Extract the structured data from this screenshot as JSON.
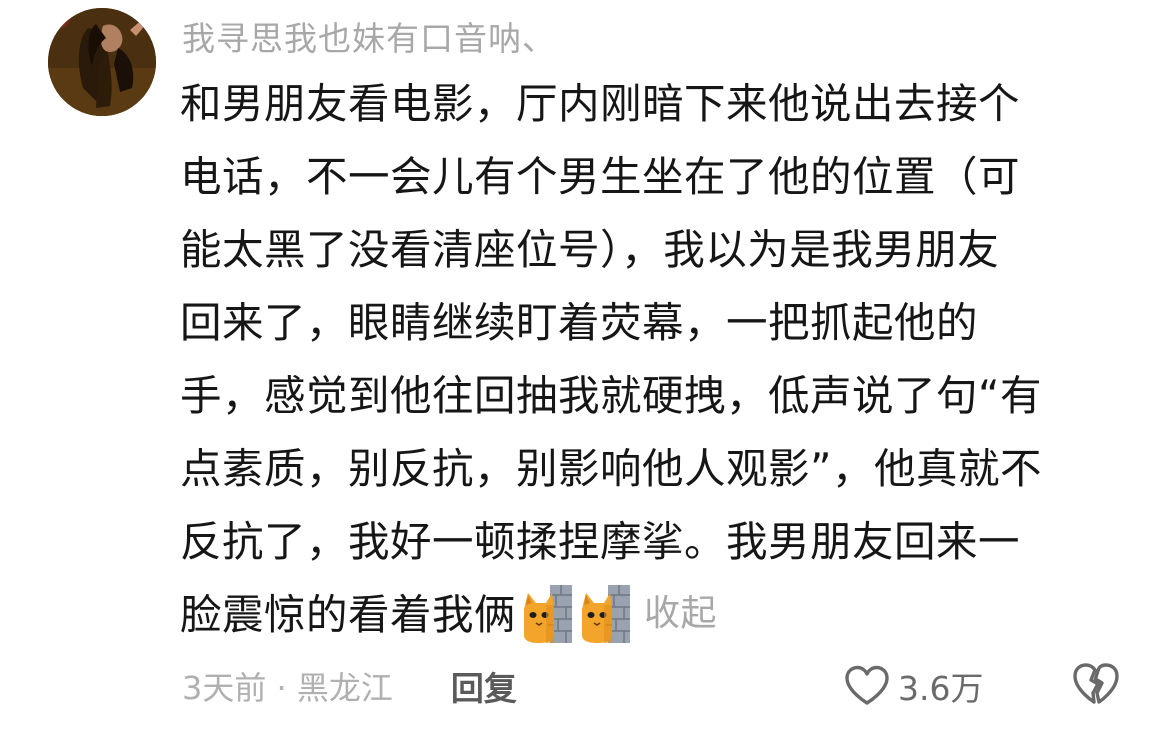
{
  "comment": {
    "username": "我寻思我也妹有口音呐、",
    "content_lines": [
      "和男朋友看电影，厅内刚暗下来他说出去接个",
      "电话，不一会儿有个男生坐在了他的位置（可",
      "能太黑了没看清座位号），我以为是我男朋友",
      "回来了，眼睛继续盯着荧幕，一把抓起他的",
      "手，感觉到他往回抽我就硬拽，低声说了句“有",
      "点素质，别反抗，别影响他人观影”，他真就不",
      "反抗了，我好一顿揉捏摩挲。我男朋友回来一",
      "脸震惊的看着我俩"
    ],
    "emojis": [
      "wall-peek-cat-icon",
      "wall-peek-cat-icon"
    ],
    "collapse_label": "收起",
    "meta": "3天前 · 黑龙江",
    "reply_label": "回复",
    "like_count": "3.6万"
  },
  "colors": {
    "text": "#161616",
    "muted": "#a8a8a8",
    "background": "#ffffff"
  }
}
